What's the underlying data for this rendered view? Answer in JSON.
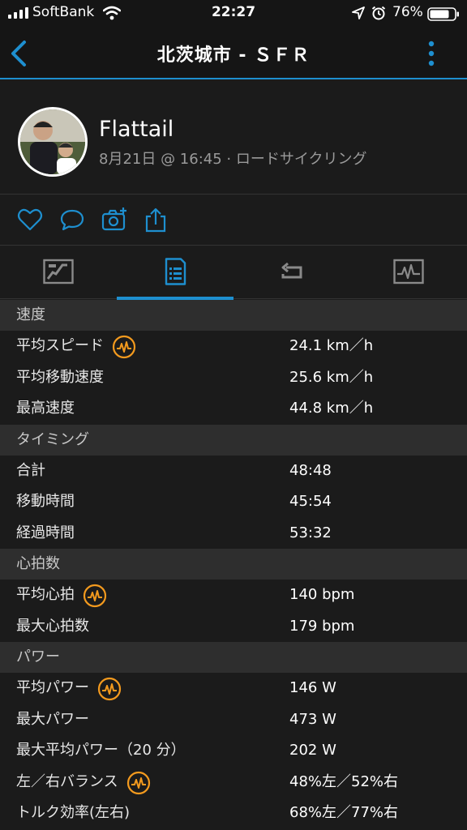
{
  "status_bar": {
    "carrier": "SoftBank",
    "time": "22:27",
    "battery": "76%"
  },
  "nav": {
    "title": "北茨城市 - ＳＦＲ"
  },
  "activity": {
    "user_name": "Flattail",
    "meta": "8月21日 @ 16:45 · ロードサイクリング"
  },
  "colors": {
    "accent": "#1e8fcf",
    "badge": "#f39a1e"
  },
  "icons": {
    "actions": [
      "heart-icon",
      "comment-icon",
      "camera-icon",
      "share-icon"
    ],
    "tabs": [
      "map-overview-icon",
      "stats-list-icon",
      "laps-icon",
      "chart-icon"
    ]
  },
  "sections": [
    {
      "title": "速度",
      "rows": [
        {
          "label": "平均スピード",
          "value": "24.1 km／h",
          "badge": true
        },
        {
          "label": "平均移動速度",
          "value": "25.6 km／h",
          "badge": false
        },
        {
          "label": "最高速度",
          "value": "44.8 km／h",
          "badge": false
        }
      ]
    },
    {
      "title": "タイミング",
      "rows": [
        {
          "label": "合計",
          "value": "48:48",
          "badge": false
        },
        {
          "label": "移動時間",
          "value": "45:54",
          "badge": false
        },
        {
          "label": "経過時間",
          "value": "53:32",
          "badge": false
        }
      ]
    },
    {
      "title": "心拍数",
      "rows": [
        {
          "label": "平均心拍",
          "value": "140 bpm",
          "badge": true
        },
        {
          "label": "最大心拍数",
          "value": "179 bpm",
          "badge": false
        }
      ]
    },
    {
      "title": "パワー",
      "rows": [
        {
          "label": "平均パワー",
          "value": "146 W",
          "badge": true
        },
        {
          "label": "最大パワー",
          "value": "473 W",
          "badge": false
        },
        {
          "label": "最大平均パワー（20 分）",
          "value": "202 W",
          "badge": false
        },
        {
          "label": "左／右バランス",
          "value": "48%左／52%右",
          "badge": true
        },
        {
          "label": "トルク効率(左右)",
          "value": "68%左／77%右",
          "badge": false
        }
      ]
    }
  ]
}
